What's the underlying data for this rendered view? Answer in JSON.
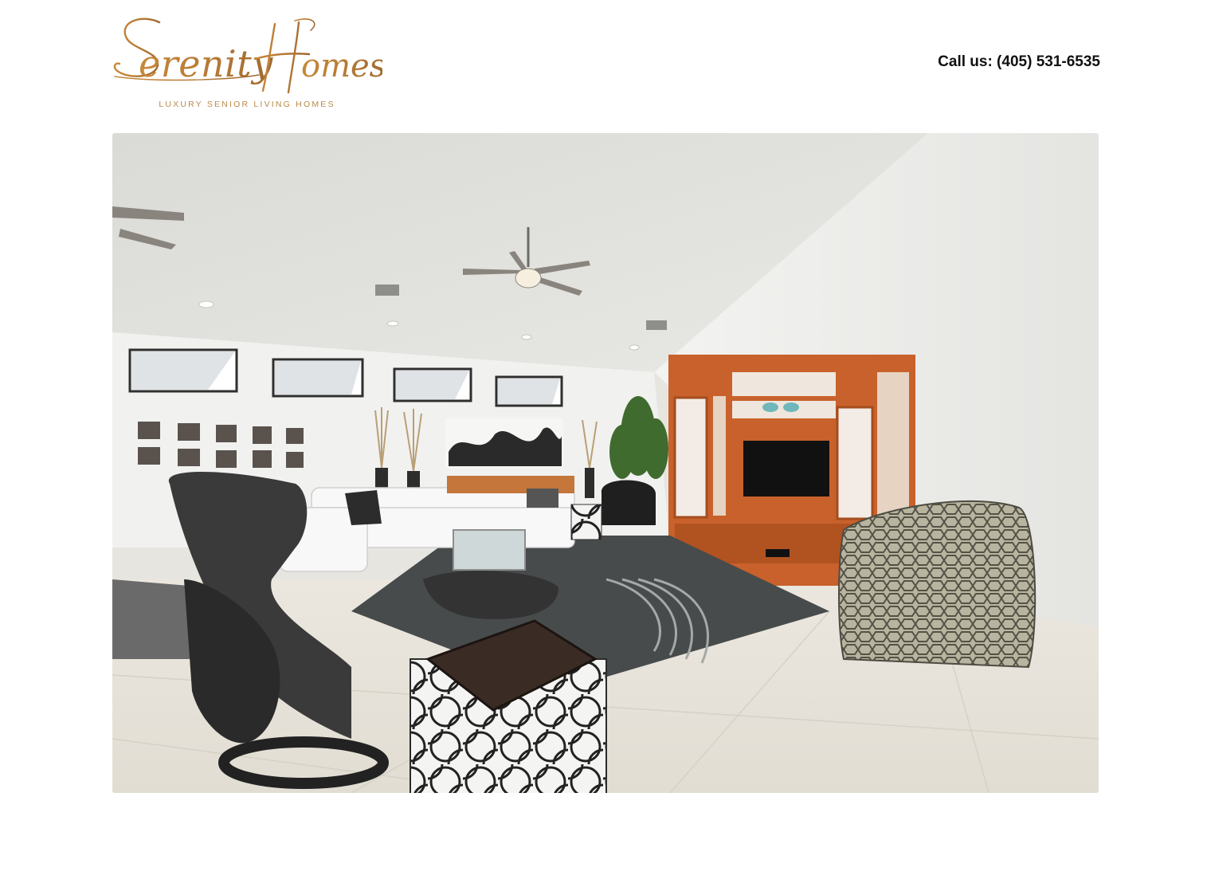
{
  "brand": {
    "name": "Serenity Homes",
    "tagline": "LUXURY SENIOR LIVING HOMES",
    "accent_color": "#b98a4a"
  },
  "header": {
    "call_label": "Call us: (405) 531-6535"
  },
  "hero": {
    "icon": "living-room-photo"
  }
}
